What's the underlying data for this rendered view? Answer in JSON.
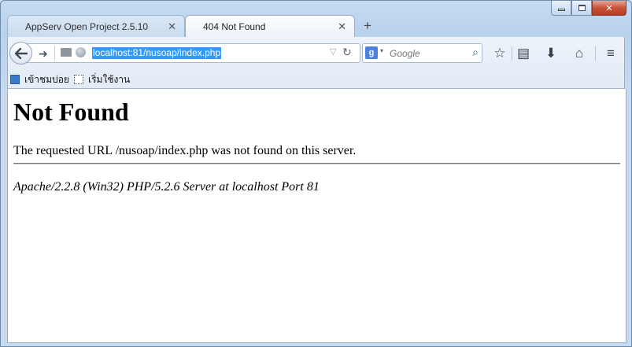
{
  "window": {
    "minimize_icon": "minimize-icon",
    "maximize_icon": "maximize-icon",
    "close_icon": "close-icon",
    "close_glyph": "✕"
  },
  "tabs": [
    {
      "title": "AppServ Open Project 2.5.10",
      "close_glyph": "✕",
      "active": false
    },
    {
      "title": "404 Not Found",
      "close_glyph": "✕",
      "active": true
    }
  ],
  "new_tab_glyph": "+",
  "navbar": {
    "back_icon": "back-arrow-icon",
    "forward_glyph": "➜",
    "url": "localhost:81/nusoap/index.php",
    "dropdown_glyph": "▽",
    "reload_glyph": "↻",
    "search": {
      "engine_badge": "g",
      "engine_dropdown_glyph": "▾",
      "placeholder": "Google",
      "search_glyph": "⌕"
    },
    "toolbar_icons": [
      {
        "name": "bookmark-star-icon",
        "glyph": "☆"
      },
      {
        "name": "bookmarks-menu-icon",
        "glyph": "▤"
      },
      {
        "name": "downloads-icon",
        "glyph": "⬇"
      },
      {
        "name": "home-icon",
        "glyph": "⌂"
      },
      {
        "name": "menu-icon",
        "glyph": "≡"
      }
    ]
  },
  "bookmarks": [
    {
      "label": "เข้าชมบ่อย",
      "icon": "most-visited-icon"
    },
    {
      "label": "เริ่มใช้งาน",
      "icon": "getting-started-icon"
    }
  ],
  "page": {
    "heading": "Not Found",
    "message": "The requested URL /nusoap/index.php was not found on this server.",
    "server_signature": "Apache/2.2.8 (Win32) PHP/5.2.6 Server at localhost Port 81"
  }
}
